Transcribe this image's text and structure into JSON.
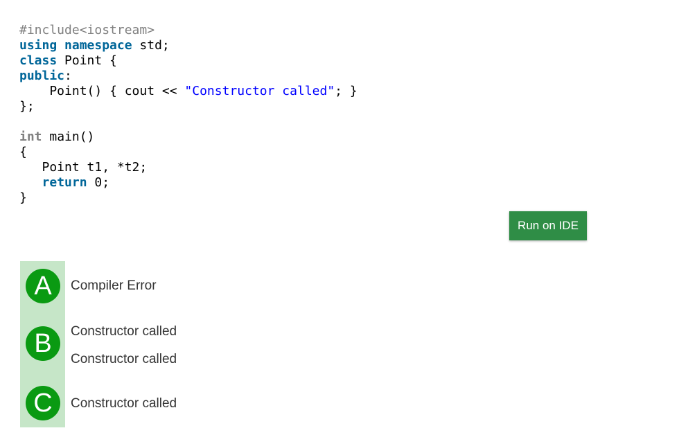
{
  "code": {
    "lines": [
      [
        {
          "t": "#include<iostream>",
          "c": "pre"
        }
      ],
      [
        {
          "t": "using",
          "c": "kw"
        },
        {
          "t": " ",
          "c": "plain"
        },
        {
          "t": "namespace",
          "c": "kw"
        },
        {
          "t": " std;",
          "c": "plain"
        }
      ],
      [
        {
          "t": "class",
          "c": "kw"
        },
        {
          "t": " Point {",
          "c": "plain"
        }
      ],
      [
        {
          "t": "public",
          "c": "kw"
        },
        {
          "t": ":",
          "c": "plain"
        }
      ],
      [
        {
          "t": "    Point() { cout << ",
          "c": "plain"
        },
        {
          "t": "\"Constructor called\"",
          "c": "str"
        },
        {
          "t": "; }",
          "c": "plain"
        }
      ],
      [
        {
          "t": "};",
          "c": "plain"
        }
      ],
      [],
      [
        {
          "t": "int",
          "c": "type"
        },
        {
          "t": " main()",
          "c": "plain"
        }
      ],
      [
        {
          "t": "{",
          "c": "plain"
        }
      ],
      [
        {
          "t": "   Point t1, *t2;",
          "c": "plain"
        }
      ],
      [
        {
          "t": "   ",
          "c": "plain"
        },
        {
          "t": "return",
          "c": "kw"
        },
        {
          "t": " 0;",
          "c": "plain"
        }
      ],
      [
        {
          "t": "}",
          "c": "plain"
        }
      ]
    ]
  },
  "run_button": {
    "label": "Run on IDE"
  },
  "options": [
    {
      "letter": "A",
      "lines": [
        "Compiler Error"
      ]
    },
    {
      "letter": "B",
      "lines": [
        "Constructor called",
        "Constructor called"
      ]
    },
    {
      "letter": "C",
      "lines": [
        "Constructor called"
      ]
    }
  ],
  "colors": {
    "run_button_bg": "#2f8d46",
    "option_badge_bg": "#0a9a12",
    "option_strip_bg": "#c6e6c8"
  }
}
